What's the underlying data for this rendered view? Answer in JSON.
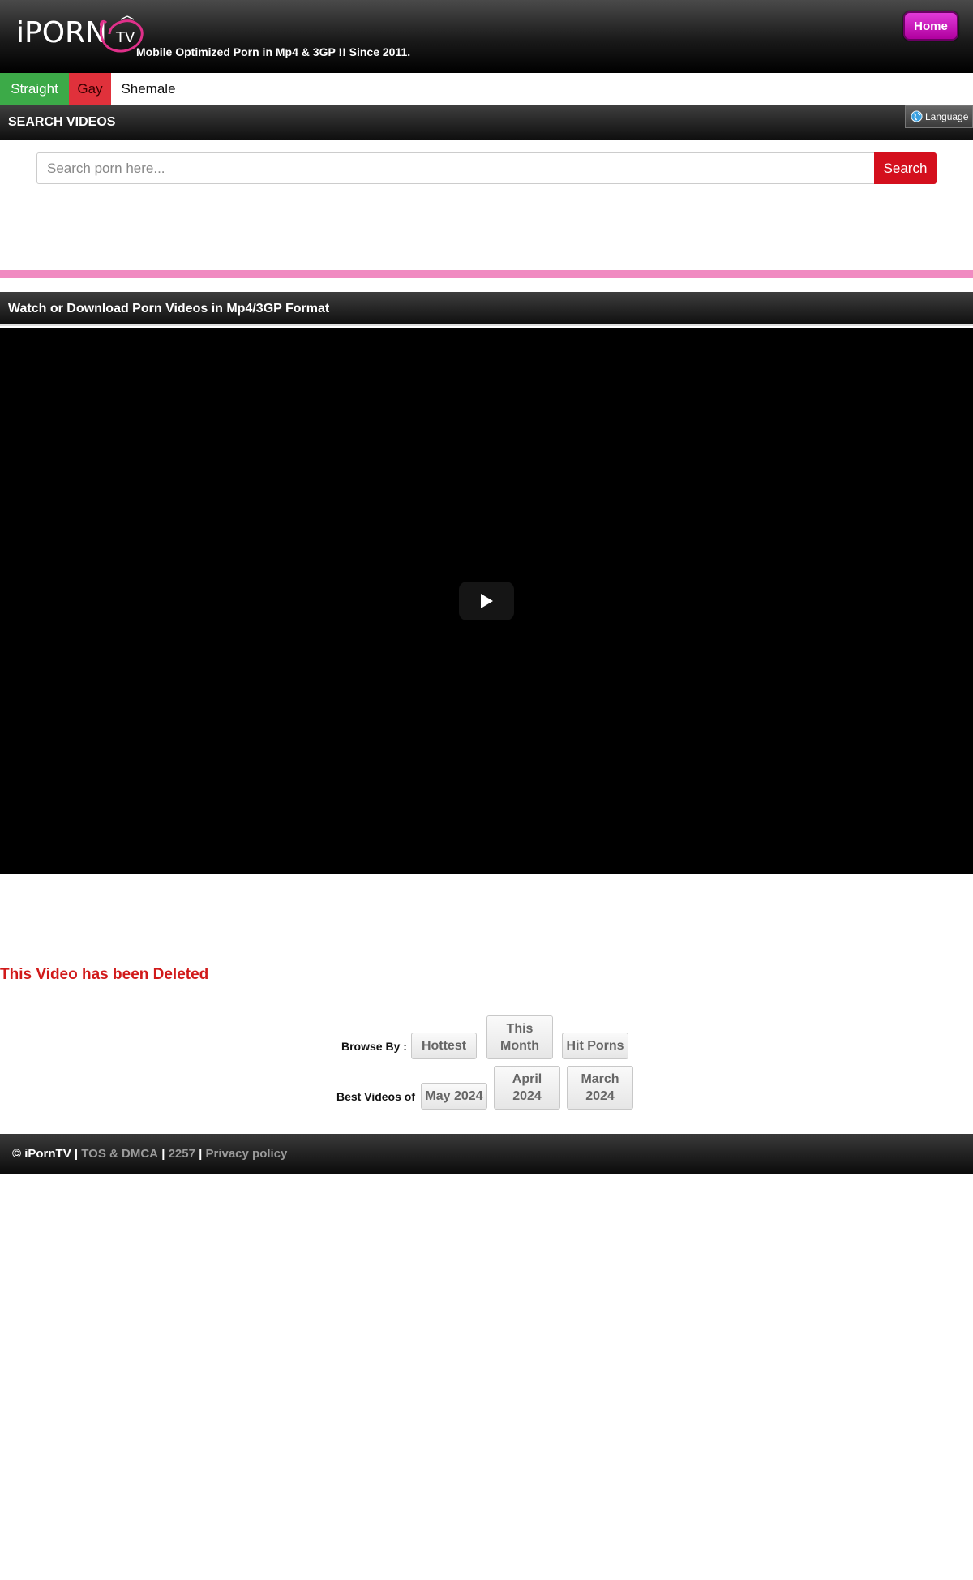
{
  "header": {
    "logo_text": "iPORN",
    "logo_badge": "TV",
    "tagline": "Mobile Optimized Porn in Mp4 & 3GP !! Since 2011.",
    "home_label": "Home"
  },
  "categories": [
    {
      "label": "Straight",
      "color": "#3caa48"
    },
    {
      "label": "Gay",
      "color": "#e0313b"
    },
    {
      "label": "Shemale",
      "color": "#ffffff"
    }
  ],
  "search": {
    "section_title": "SEARCH VIDEOS",
    "language_label": "Language",
    "placeholder": "Search porn here...",
    "button_label": "Search"
  },
  "video": {
    "section_title": "Watch or Download Porn Videos in Mp4/3GP Format",
    "play_icon": "play-icon",
    "status_message": "This Video has been Deleted"
  },
  "browse": {
    "label": "Browse By :",
    "options": [
      "Hottest",
      "This Month",
      "Hit Porns"
    ]
  },
  "best_videos": {
    "label": "Best Videos of",
    "options": [
      "May 2024",
      "April 2024",
      "March 2024"
    ]
  },
  "footer": {
    "copyright": "© iPornTV",
    "links": [
      "TOS & DMCA",
      "2257",
      "Privacy policy"
    ]
  },
  "colors": {
    "accent_pink": "#f08ac1",
    "home_button": "#c91fc0",
    "search_button": "#d40f1d",
    "deleted_text": "#d11a1a"
  }
}
